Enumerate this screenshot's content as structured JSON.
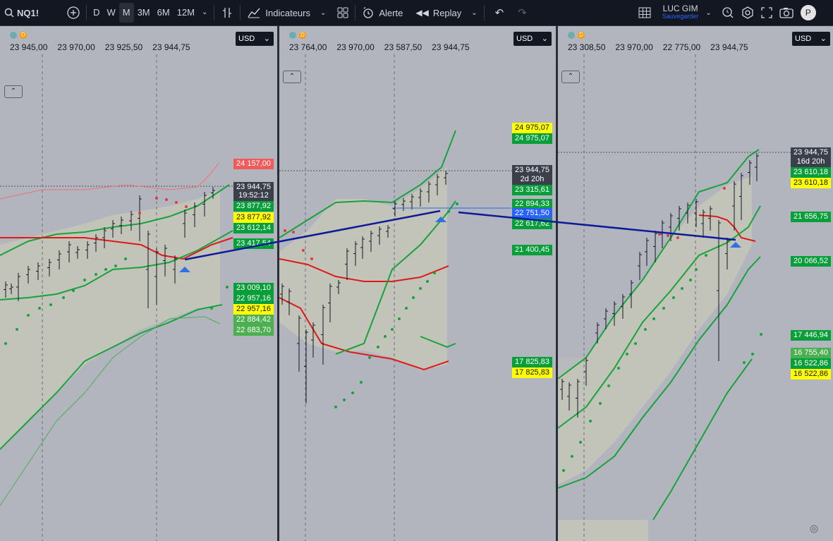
{
  "toolbar": {
    "symbol": "NQ1!",
    "timeframes": [
      "D",
      "W",
      "M",
      "3M",
      "6M",
      "12M"
    ],
    "active_timeframe": "M",
    "indicators_label": "Indicateurs",
    "alert_label": "Alerte",
    "replay_label": "Replay",
    "layout_name": "LUC GIM",
    "save_label": "Sauvegarder",
    "avatar_letter": "P"
  },
  "panels": [
    {
      "ohlc": [
        "23 945,00",
        "23 970,00",
        "23 925,50",
        "23 944,75"
      ],
      "currency": "USD",
      "labels": [
        {
          "text": "24 157,00",
          "cls": "r"
        },
        {
          "text": "23 944,75",
          "cls": "d"
        },
        {
          "text": "19:52:12",
          "cls": "d"
        },
        {
          "text": "23 877,92",
          "cls": "g"
        },
        {
          "text": "23 877,92",
          "cls": "y"
        },
        {
          "text": "23 612,14",
          "cls": "g"
        },
        {
          "text": "23 417,54",
          "cls": "g"
        },
        {
          "text": "23 009,10",
          "cls": "g"
        },
        {
          "text": "22 957,16",
          "cls": "g"
        },
        {
          "text": "22 957,16",
          "cls": "y"
        },
        {
          "text": "22 884,42",
          "cls": "lg"
        },
        {
          "text": "22 683,70",
          "cls": "lg"
        }
      ]
    },
    {
      "ohlc": [
        "23 764,00",
        "23 970,00",
        "23 587,50",
        "23 944,75"
      ],
      "currency": "USD",
      "labels": [
        {
          "text": "24 975,07",
          "cls": "y"
        },
        {
          "text": "24 975,07",
          "cls": "g"
        },
        {
          "text": "23 944,75",
          "cls": "d"
        },
        {
          "text": "2d 20h",
          "cls": "d"
        },
        {
          "text": "23 315,61",
          "cls": "g"
        },
        {
          "text": "22 894,33",
          "cls": "g"
        },
        {
          "text": "22 751,50",
          "cls": "b"
        },
        {
          "text": "22 617,62",
          "cls": "g"
        },
        {
          "text": "21 400,45",
          "cls": "g"
        },
        {
          "text": "17 825,83",
          "cls": "g"
        },
        {
          "text": "17 825,83",
          "cls": "y"
        }
      ]
    },
    {
      "ohlc": [
        "23 308,50",
        "23 970,00",
        "22 775,00",
        "23 944,75"
      ],
      "currency": "USD",
      "labels": [
        {
          "text": "23 944,75",
          "cls": "d"
        },
        {
          "text": "16d 20h",
          "cls": "d"
        },
        {
          "text": "23 610,18",
          "cls": "g"
        },
        {
          "text": "23 610,18",
          "cls": "y"
        },
        {
          "text": "21 656,75",
          "cls": "g"
        },
        {
          "text": "20 066,52",
          "cls": "g"
        },
        {
          "text": "17 446,94",
          "cls": "g"
        },
        {
          "text": "16 755,40",
          "cls": "lg"
        },
        {
          "text": "16 522,86",
          "cls": "g"
        },
        {
          "text": "16 522,86",
          "cls": "y"
        }
      ]
    }
  ],
  "colors": {
    "band_green": "#16a33a",
    "band_red": "#e01818",
    "trendline": "#0d1a9a",
    "fill": "#c7c9b8",
    "arrow": "#2f6fe8"
  }
}
